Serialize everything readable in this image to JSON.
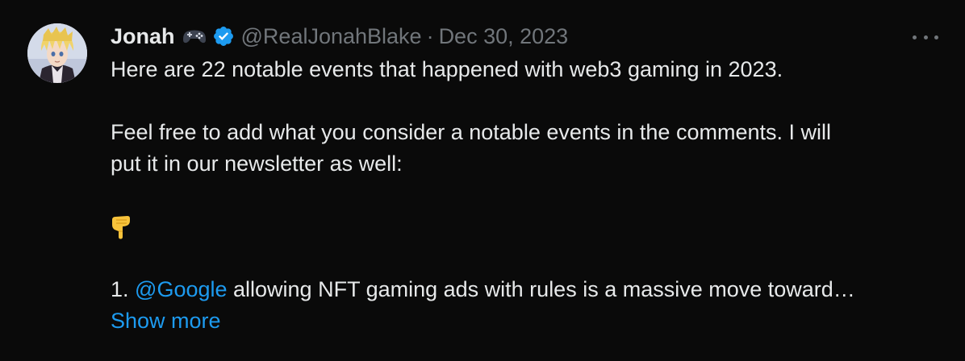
{
  "tweet": {
    "author_name": "Jonah",
    "name_emoji_icon": "game-controller-icon",
    "verified_icon": "verified-badge-icon",
    "handle": "@RealJonahBlake",
    "separator": "·",
    "date": "Dec 30, 2023",
    "more_icon": "more-dots-icon",
    "lines": {
      "line1": "Here are 22 notable events that happened with web3 gaming in 2023.",
      "line2": "Feel free to add what you consider a notable events in the comments. I will",
      "line3": "put it in our newsletter as well:",
      "pointing_emoji_icon": "pointing-down-hand-icon",
      "item_prefix": "1. ",
      "mention": "@Google",
      "item_rest": " allowing NFT gaming ads with rules is a massive move toward…"
    },
    "show_more": "Show more"
  },
  "colors": {
    "background": "#0a0a0a",
    "text": "#e7e9ea",
    "muted": "#71767b",
    "link": "#1d9bf0",
    "verified": "#1d9bf0"
  }
}
